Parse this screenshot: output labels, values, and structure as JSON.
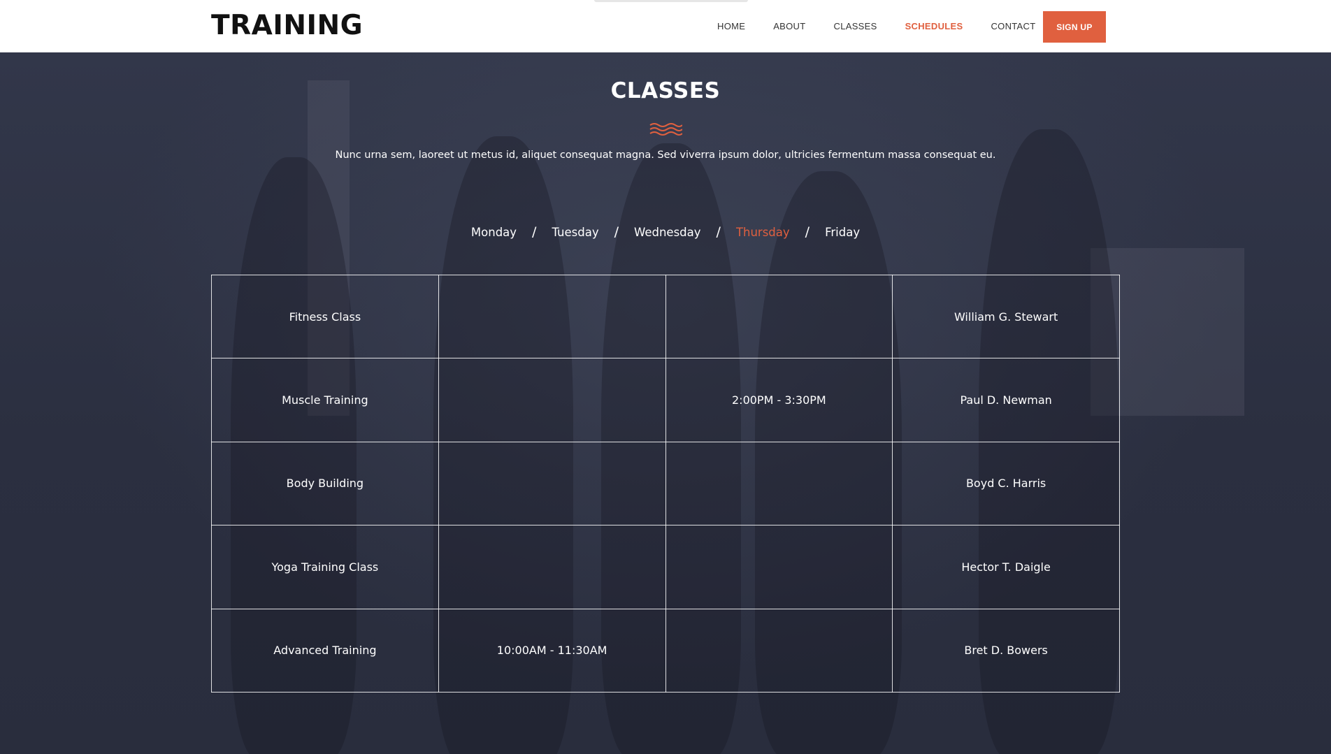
{
  "header": {
    "logo": "TRAINING",
    "nav": [
      "HOME",
      "ABOUT",
      "CLASSES",
      "SCHEDULES",
      "CONTACT"
    ],
    "active_nav": "SCHEDULES",
    "signup_label": "SIGN UP"
  },
  "section": {
    "title": "CLASSES",
    "description": "Nunc urna sem, laoreet ut metus id, aliquet consequat magna. Sed viverra ipsum dolor, ultricies fermentum massa consequat eu.",
    "icon": "wave-icon"
  },
  "days": {
    "items": [
      "Monday",
      "Tuesday",
      "Wednesday",
      "Thursday",
      "Friday"
    ],
    "separator": "/",
    "active": "Thursday"
  },
  "schedule": {
    "rows": [
      [
        "Fitness Class",
        "",
        "",
        "William G. Stewart"
      ],
      [
        "Muscle Training",
        "",
        "2:00PM - 3:30PM",
        "Paul D. Newman"
      ],
      [
        "Body Building",
        "",
        "",
        "Boyd C. Harris"
      ],
      [
        "Yoga Training Class",
        "",
        "",
        "Hector T. Daigle"
      ],
      [
        "Advanced Training",
        "10:00AM - 11:30AM",
        "",
        "Bret D. Bowers"
      ]
    ]
  },
  "colors": {
    "accent": "#e0603f",
    "overlay": "#2c3041",
    "header_bg": "#ffffff"
  }
}
